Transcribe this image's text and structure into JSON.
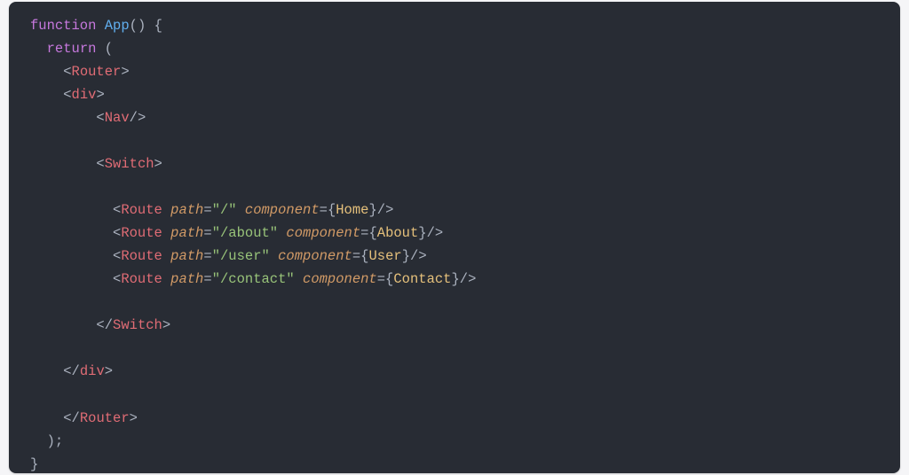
{
  "colors": {
    "background": "#282c34",
    "keyword": "#c678dd",
    "function": "#61afef",
    "component": "#e06c75",
    "attribute": "#d19a66",
    "string": "#98c379",
    "value": "#e5c07b",
    "default": "#abb2bf"
  },
  "tok": {
    "function": "function",
    "App": "App",
    "return": "return",
    "Router": "Router",
    "div": "div",
    "Nav": "Nav",
    "Switch": "Switch",
    "Route": "Route",
    "path": "path",
    "component": "component",
    "pathHome": "\"/\"",
    "pathAbout": "\"/about\"",
    "pathUser": "\"/user\"",
    "pathContact": "\"/contact\"",
    "Home": "Home",
    "About": "About",
    "User": "User",
    "Contact": "Contact",
    "openTag": "<",
    "closeTag": ">",
    "slash": "/",
    "openBrace": "{",
    "closeBrace": "}",
    "openParen": "(",
    "closeParen": ")",
    "parens": "()",
    "eq": "=",
    "semi": ";",
    "space": " "
  }
}
